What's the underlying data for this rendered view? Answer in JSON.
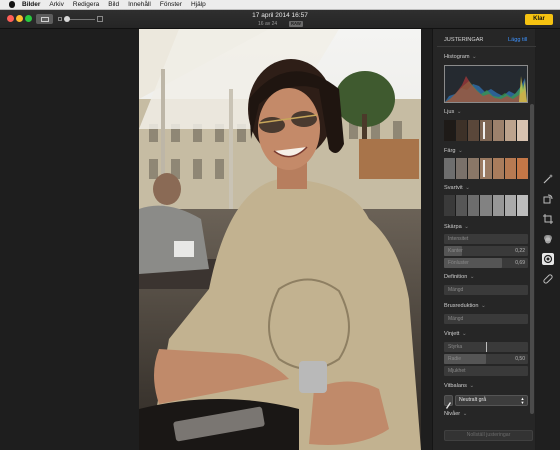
{
  "menubar": {
    "items": [
      "Bilder",
      "Arkiv",
      "Redigera",
      "Bild",
      "Innehåll",
      "Fönster",
      "Hjälp"
    ]
  },
  "toolbar": {
    "title": "17 april 2014 16:57",
    "subtitle": "16 av 24",
    "badge": "RAW",
    "done_label": "Klar"
  },
  "panel": {
    "tab_adjustments": "JUSTERINGAR",
    "tab_add": "Lägg till",
    "histogram_label": "Histogram",
    "light_label": "Ljus",
    "color_label": "Färg",
    "bw_label": "Svartvit",
    "sharpen": {
      "label": "Skärpa",
      "fields": [
        {
          "label": "Intensitet",
          "value": "",
          "fill": 0.0
        },
        {
          "label": "Kanter",
          "value": "0,22",
          "fill": 0.22
        },
        {
          "label": "Fönluster",
          "value": "0,69",
          "fill": 0.69
        }
      ]
    },
    "definition": {
      "label": "Definition",
      "field": "Mängd"
    },
    "noise": {
      "label": "Brusreduktion",
      "field": "Mängd"
    },
    "vignette": {
      "label": "Vinjett",
      "fields": [
        {
          "label": "Styrka",
          "value": "",
          "fill": 0.5
        },
        {
          "label": "Radie",
          "value": "0,50",
          "fill": 0.5
        },
        {
          "label": "Mjukhet",
          "value": "",
          "fill": 0.0
        }
      ]
    },
    "white_balance": {
      "label": "Vitbalans",
      "selected": "Neutralt grå"
    },
    "levels_label": "Nivåer",
    "reset_label": "Nollställ justeringar"
  },
  "tools": [
    "magic-wand-icon",
    "rotate-icon",
    "crop-icon",
    "filters-icon",
    "adjust-icon",
    "retouch-icon"
  ],
  "colors": {
    "accent_blue": "#3e93ff",
    "done_yellow": "#f5c211",
    "panel_bg": "#262626"
  }
}
